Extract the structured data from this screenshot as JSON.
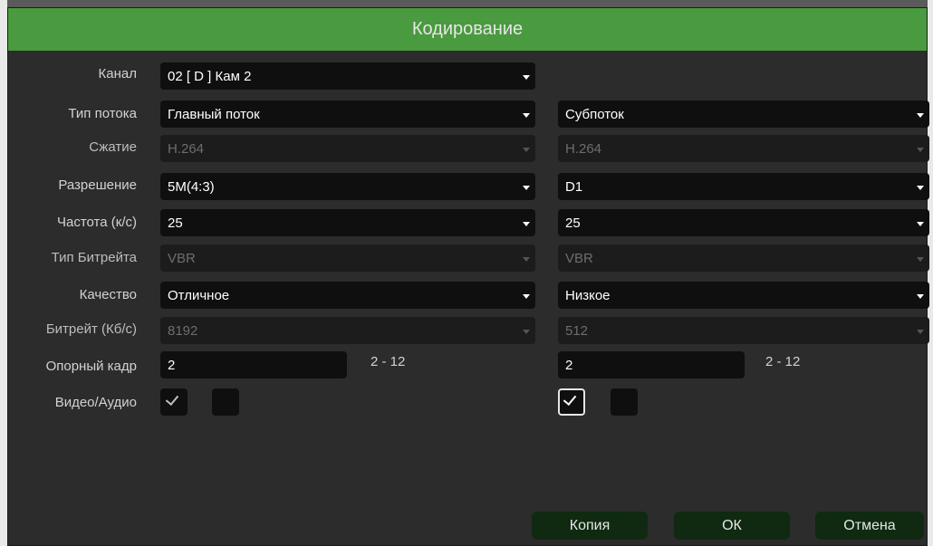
{
  "dialog": {
    "title": "Кодирование"
  },
  "labels": {
    "channel": "Канал",
    "stream_type": "Тип потока",
    "compression": "Сжатие",
    "resolution": "Разрешение",
    "framerate": "Частота (к/с)",
    "bitrate_type": "Тип Битрейта",
    "quality": "Качество",
    "bitrate": "Битрейт (Кб/с)",
    "keyframe": "Опорный кадр",
    "video_audio": "Видео/Аудио"
  },
  "channel": {
    "value": "02 [ D ] Кам 2"
  },
  "main": {
    "stream_type": "Главный поток",
    "compression": "H.264",
    "resolution": "5M(4:3)",
    "framerate": "25",
    "bitrate_type": "VBR",
    "quality": "Отличное",
    "bitrate": "8192",
    "keyframe": "2",
    "keyframe_range": "2 - 12",
    "video_checked": true,
    "audio_checked": false
  },
  "sub": {
    "stream_type": "Субпоток",
    "compression": "H.264",
    "resolution": "D1",
    "framerate": "25",
    "bitrate_type": "VBR",
    "quality": "Низкое",
    "bitrate": "512",
    "keyframe": "2",
    "keyframe_range": "2 - 12",
    "video_checked": true,
    "audio_checked": false
  },
  "buttons": {
    "copy": "Копия",
    "ok": "ОК",
    "cancel": "Отмена"
  },
  "colors": {
    "title_bar": "#4a9a3f",
    "background": "#2c2c2c",
    "field": "#0f0f0f",
    "button": "#0f2a10"
  },
  "icons": [
    "dropdown-arrow-icon",
    "checkmark-icon"
  ]
}
